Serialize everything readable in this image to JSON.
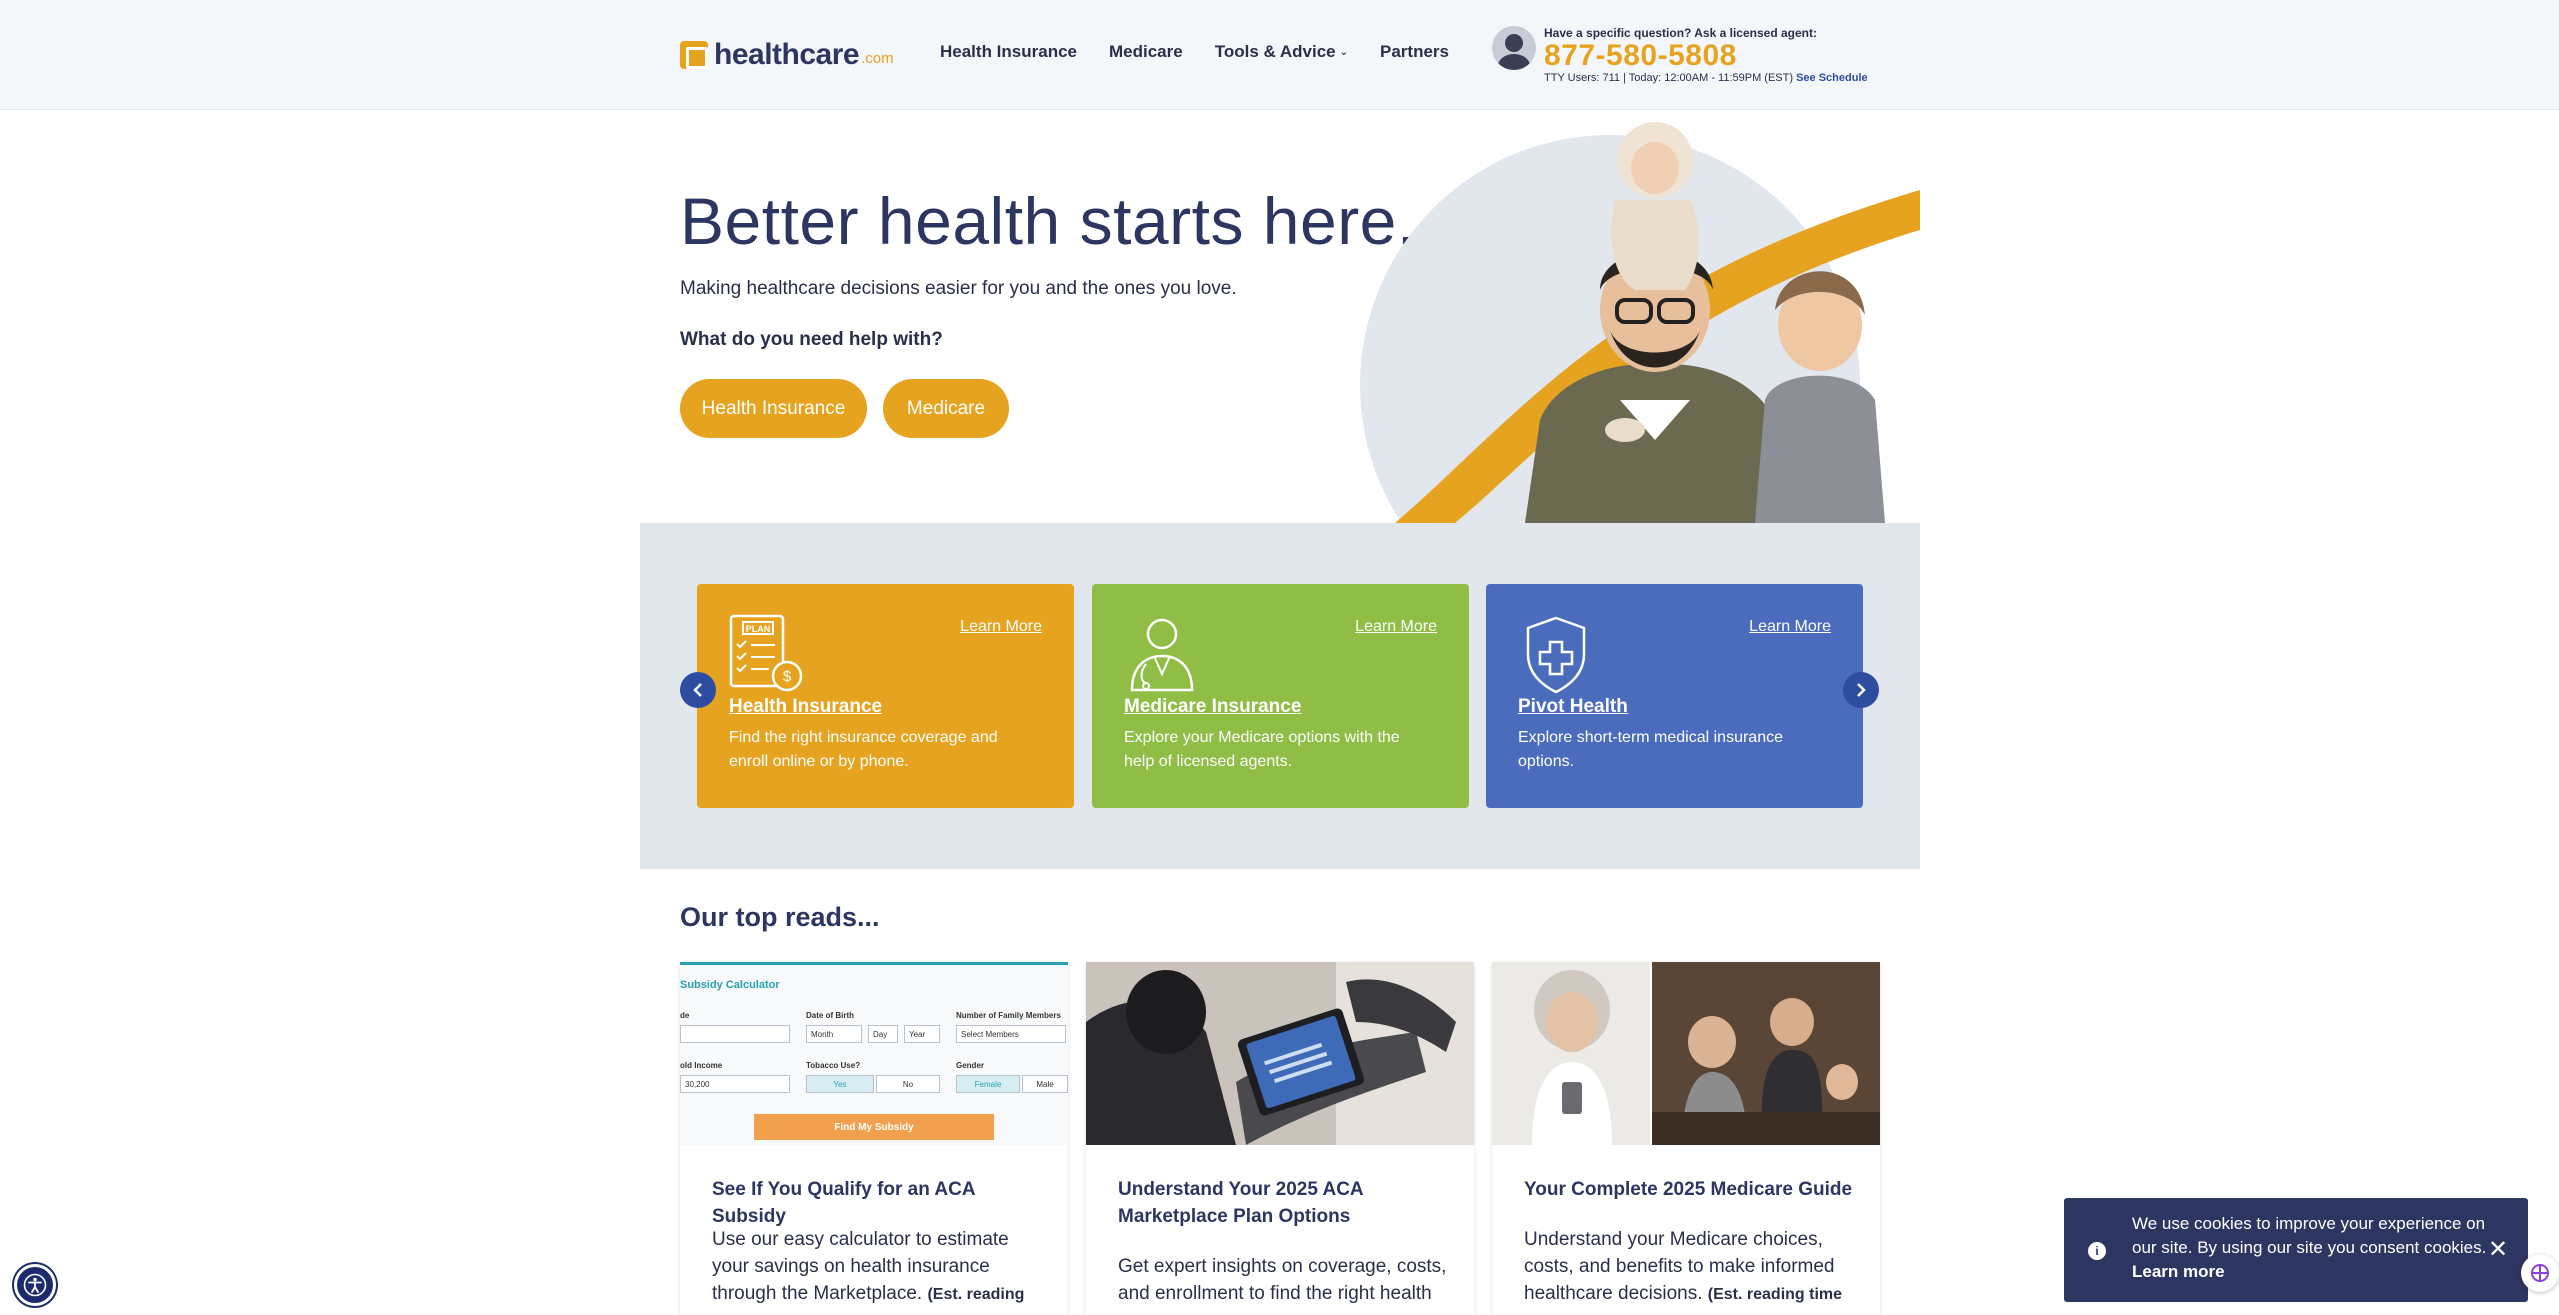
{
  "header": {
    "logo_text": "healthcare",
    "logo_suffix": ".com",
    "nav": [
      {
        "label": "Health Insurance"
      },
      {
        "label": "Medicare"
      },
      {
        "label": "Tools & Advice"
      },
      {
        "label": "Partners"
      }
    ],
    "agent": {
      "question": "Have a specific question? Ask a licensed agent:",
      "phone": "877-580-5808",
      "tty": "TTY Users: 711 | Today: 12:00AM - 11:59PM (EST)",
      "schedule_link": "See Schedule"
    }
  },
  "hero": {
    "title": "Better health starts here.",
    "subtitle": "Making healthcare decisions easier for you and the ones you love.",
    "question": "What do you need help with?",
    "buttons": [
      "Health Insurance",
      "Medicare"
    ]
  },
  "services": [
    {
      "title": "Health Insurance",
      "desc": "Find the right insurance coverage and enroll online or by phone.",
      "link": "Learn More",
      "icon": "plan-document-icon"
    },
    {
      "title": "Medicare Insurance",
      "desc": "Explore your Medicare options with the help of licensed agents.",
      "link": "Learn More",
      "icon": "agent-person-icon"
    },
    {
      "title": "Pivot Health",
      "desc": "Explore short-term medical insurance options.",
      "link": "Learn More",
      "icon": "medical-shield-icon"
    }
  ],
  "reads": {
    "title": "Our top reads...",
    "items": [
      {
        "title": "See If You Qualify for an ACA Subsidy",
        "desc": "Use our easy calculator to estimate your savings on health insurance through the Marketplace.",
        "est": "(Est. reading"
      },
      {
        "title": "Understand Your 2025 ACA Marketplace Plan Options",
        "desc": "Get expert insights on coverage, costs, and enrollment to find the right health"
      },
      {
        "title": "Your Complete 2025 Medicare Guide",
        "desc": "Understand your Medicare choices, costs, and benefits to make informed healthcare decisions.",
        "est": "(Est. reading time"
      }
    ],
    "calculator": {
      "title": "Subsidy Calculator",
      "labels": [
        "de",
        "Date of Birth",
        "Number of Family Members",
        "old Income",
        "Tobacco Use?",
        "Gender"
      ],
      "fields": [
        "Month",
        "Day",
        "Year",
        "Select Members",
        "30,200"
      ],
      "options": [
        "Yes",
        "No",
        "Female",
        "Male"
      ],
      "button": "Find My Subsidy"
    }
  },
  "cookie": {
    "text": "We use cookies to improve your experience on our site. By using our site you consent cookies.",
    "link": "Learn more"
  },
  "colors": {
    "brand_gold": "#e5a320",
    "navy": "#2d3561",
    "green": "#8fbd45",
    "blue": "#4b6bbd"
  }
}
